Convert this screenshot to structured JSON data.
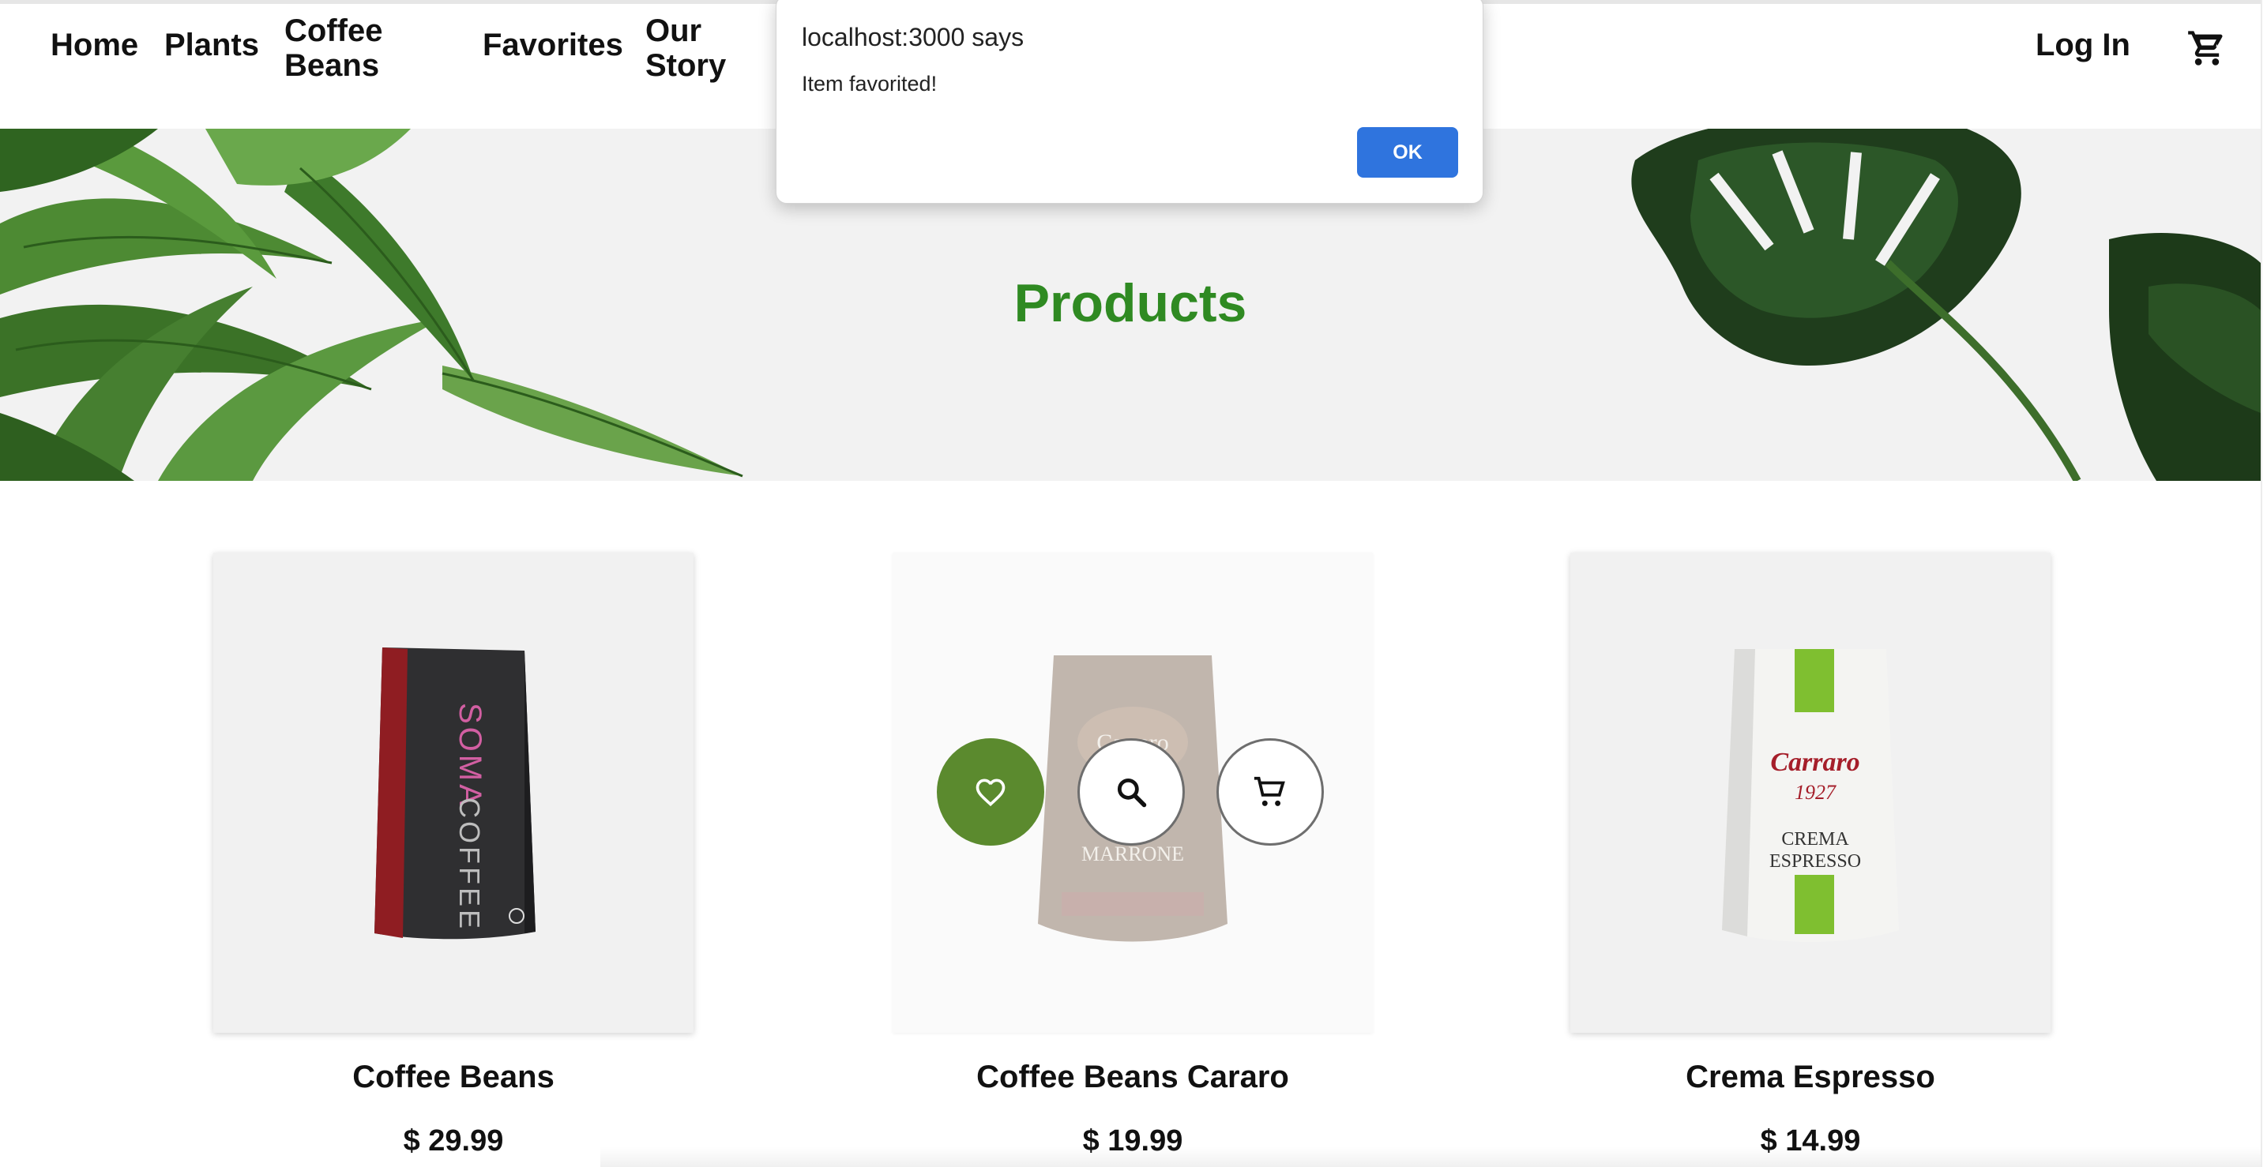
{
  "nav": {
    "items": [
      {
        "label": "Home"
      },
      {
        "label": "Plants"
      },
      {
        "label": "Coffee Beans"
      },
      {
        "label": "Favorites"
      },
      {
        "label": "Our Story"
      }
    ],
    "login_label": "Log In",
    "cart_icon": "shopping-cart-icon"
  },
  "hero": {
    "title": "Products",
    "title_color": "#2f8a22",
    "left_image": "fern-plant",
    "right_image": "monstera-leaf"
  },
  "products": [
    {
      "name": "Coffee Beans",
      "price": "$ 29.99",
      "bag_brand": "SOMA",
      "bag_text": "COFFEE"
    },
    {
      "name": "Coffee Beans Cararo",
      "price": "$ 19.99",
      "bag_brand": "Carraro",
      "bag_text": "MARRONE",
      "hover": true
    },
    {
      "name": "Crema Espresso",
      "price": "$ 14.99",
      "bag_brand": "Carraro",
      "bag_year": "1927",
      "bag_text_1": "CREMA",
      "bag_text_2": "ESPRESSO"
    }
  ],
  "overlay_buttons": {
    "favorite_icon": "heart-icon",
    "view_icon": "search-icon",
    "cart_icon": "cart-icon",
    "favorite_color": "#5b8a2e"
  },
  "dialog": {
    "title": "localhost:3000 says",
    "message": "Item favorited!",
    "ok_label": "OK",
    "ok_color": "#2f74de"
  }
}
